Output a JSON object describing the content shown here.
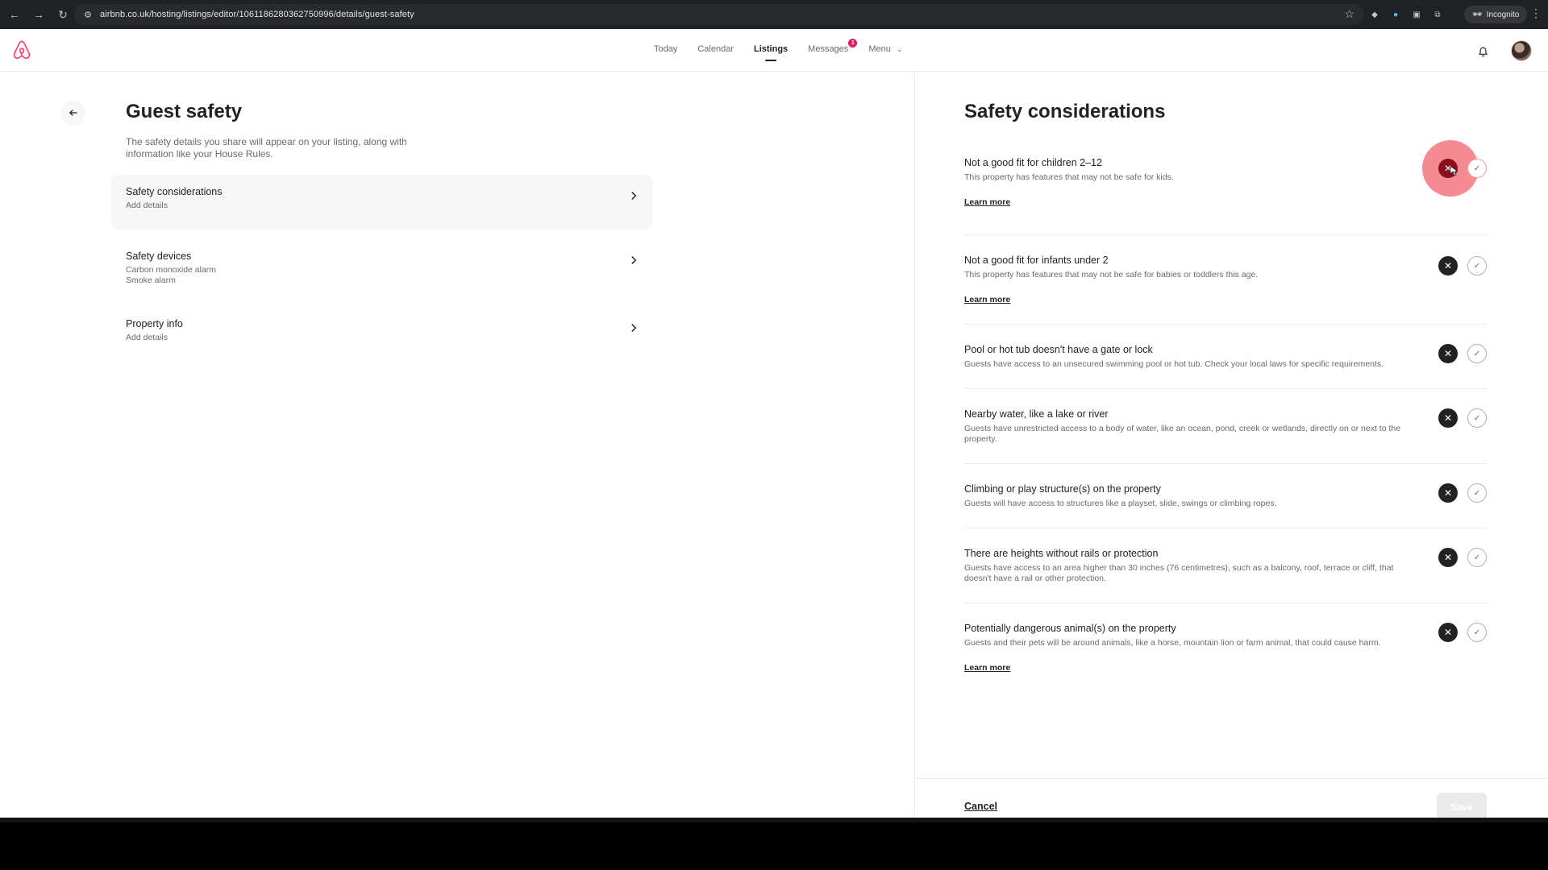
{
  "browser": {
    "url": "airbnb.co.uk/hosting/listings/editor/1061186280362750996/details/guest-safety",
    "profile_label": "Incognito"
  },
  "topnav": {
    "links": [
      "Today",
      "Calendar",
      "Listings",
      "Messages",
      "Menu"
    ],
    "active": "Listings",
    "messages_badge": "1"
  },
  "left": {
    "title": "Guest safety",
    "intro": "The safety details you share will appear on your listing, along with information like your House Rules.",
    "sections": [
      {
        "title": "Safety considerations",
        "sub": [
          "Add details"
        ]
      },
      {
        "title": "Safety devices",
        "sub": [
          "Carbon monoxide alarm",
          "Smoke alarm"
        ]
      },
      {
        "title": "Property info",
        "sub": [
          "Add details"
        ]
      }
    ]
  },
  "right": {
    "title": "Safety considerations",
    "learn_more": "Learn more",
    "items": [
      {
        "title": "Not a good fit for children 2–12",
        "desc": "This property has features that may not be safe for kids.",
        "learn_more": true
      },
      {
        "title": "Not a good fit for infants under 2",
        "desc": "This property has features that may not be safe for babies or toddlers this age.",
        "learn_more": true
      },
      {
        "title": "Pool or hot tub doesn't have a gate or lock",
        "desc": "Guests have access to an unsecured swimming pool or hot tub. Check your local laws for specific requirements.",
        "learn_more": false
      },
      {
        "title": "Nearby water, like a lake or river",
        "desc": "Guests have unrestricted access to a body of water, like an ocean, pond, creek or wetlands, directly on or next to the property.",
        "learn_more": false
      },
      {
        "title": "Climbing or play structure(s) on the property",
        "desc": "Guests will have access to structures like a playset, slide, swings or climbing ropes.",
        "learn_more": false
      },
      {
        "title": "There are heights without rails or protection",
        "desc": "Guests have access to an area higher than 30 inches (76 centimetres), such as a balcony, roof, terrace or cliff, that doesn't have a rail or other protection.",
        "learn_more": false
      },
      {
        "title": "Potentially dangerous animal(s) on the property",
        "desc": "Guests and their pets will be around animals, like a horse, mountain lion or farm animal, that could cause harm.",
        "learn_more": true
      }
    ],
    "cancel": "Cancel",
    "save": "Save"
  },
  "colors": {
    "brand": "#ff385c",
    "badge": "#e31c5f",
    "text": "#222222",
    "muted": "#6a6a6a"
  },
  "icons": [
    "back-arrow-icon",
    "reload-icon",
    "star-icon",
    "bell-icon",
    "chevron-right-icon",
    "x-icon",
    "check-icon",
    "airbnb-logo-icon"
  ]
}
